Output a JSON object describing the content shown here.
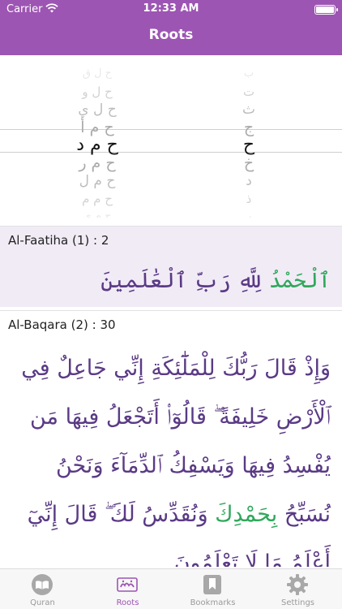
{
  "status_bar": {
    "carrier": "Carrier",
    "time": "12:33 AM"
  },
  "header": {
    "title": "Roots"
  },
  "picker": {
    "left_column": [
      "ح ل ق",
      "ح ل و",
      "ح ل ي",
      "ح م أ",
      "ح م د",
      "ح م ر",
      "ح م ل",
      "ح م م",
      "ح م ي"
    ],
    "right_column": [
      "ب",
      "ت",
      "ث",
      "ج",
      "ح",
      "خ",
      "د",
      "ذ",
      "ر"
    ]
  },
  "results": [
    {
      "reference": "Al-Faatiha (1) : 2",
      "highlight": "ٱلْحَمْدُ",
      "text": " لِلَّهِ رَبِّ ٱلْعَٰلَمِينَ"
    },
    {
      "reference": "Al-Baqara (2) : 30",
      "text": "وَإِذْ قَالَ رَبُّكَ لِلْمَلَٰٓئِكَةِ إِنِّي جَاعِلٌ فِي ٱلْأَرْضِ خَلِيفَةً ۖ قَالُوٓا۟ أَتَجْعَلُ فِيهَا مَن يُفْسِدُ فِيهَا وَيَسْفِكُ ٱلدِّمَآءَ وَنَحْنُ نُسَبِّحُ ",
      "highlight": "بِحَمْدِكَ",
      "text_after": " وَنُقَدِّسُ لَكَ ۖ قَالَ إِنِّيٓ أَعْلَمُ مَا لَا تَعْلَمُونَ"
    }
  ],
  "tabs": [
    {
      "label": "Quran",
      "icon": "quran-book-icon"
    },
    {
      "label": "Roots",
      "icon": "roots-icon"
    },
    {
      "label": "Bookmarks",
      "icon": "bookmark-icon"
    },
    {
      "label": "Settings",
      "icon": "gear-icon"
    }
  ],
  "colors": {
    "accent": "#9d55b3",
    "verse": "#5a3a85",
    "highlight": "#2fa85b",
    "selected_bg": "#f1ebf6"
  }
}
